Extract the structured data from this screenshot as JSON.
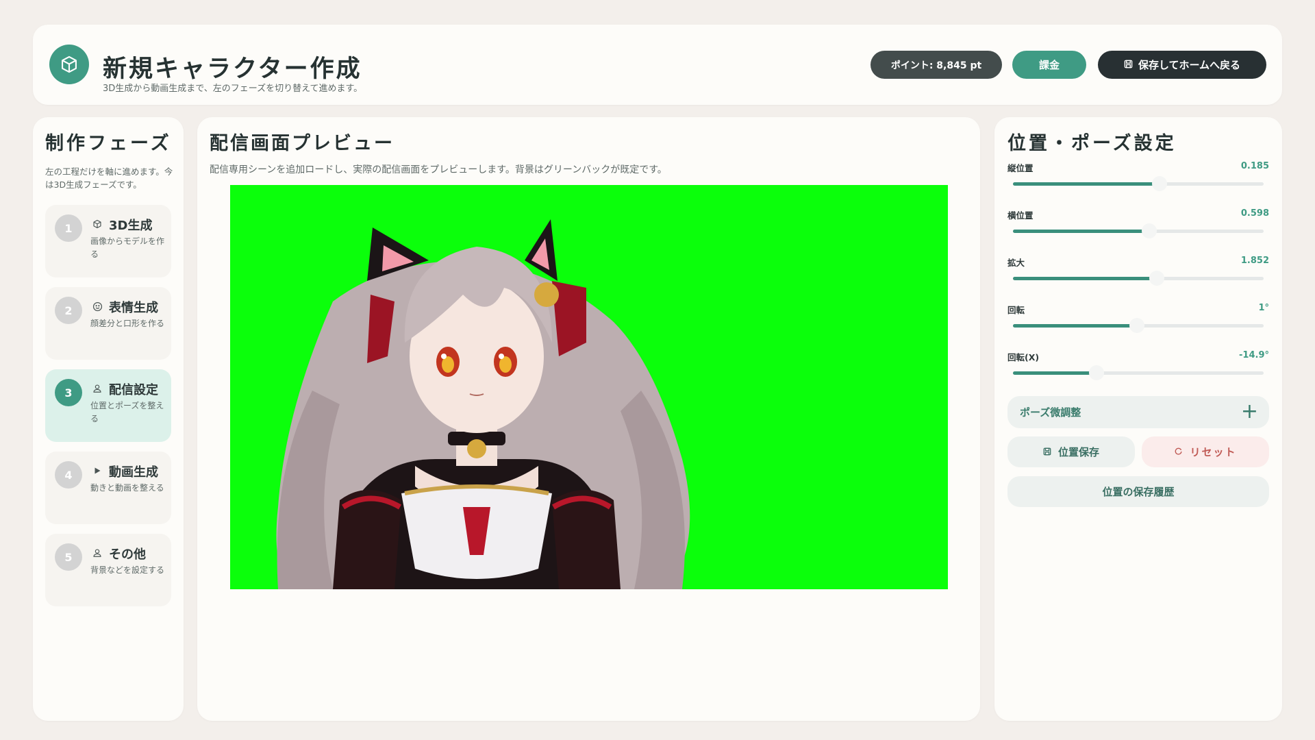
{
  "header": {
    "title": "新規キャラクター作成",
    "subtitle": "3D生成から動画生成まで、左のフェーズを切り替えて進めます。",
    "points": "ポイント: 8,845 pt",
    "charge": "課金",
    "save_home": "保存してホームへ戻る",
    "logo_icon": "cube-icon"
  },
  "sidebar": {
    "title": "制作フェーズ",
    "description": "左の工程だけを軸に進めます。今は3D生成フェーズです。",
    "phases": [
      {
        "num": "1",
        "icon": "cube-icon",
        "label": "3D生成",
        "desc": "画像からモデルを作る",
        "active": false
      },
      {
        "num": "2",
        "icon": "smile-icon",
        "label": "表情生成",
        "desc": "顔差分と口形を作る",
        "active": false
      },
      {
        "num": "3",
        "icon": "person-icon",
        "label": "配信設定",
        "desc": "位置とポーズを整える",
        "active": true
      },
      {
        "num": "4",
        "icon": "play-icon",
        "label": "動画生成",
        "desc": "動きと動画を整える",
        "active": false
      },
      {
        "num": "5",
        "icon": "person-icon",
        "label": "その他",
        "desc": "背景などを設定する",
        "active": false
      }
    ]
  },
  "preview": {
    "title": "配信画面プレビュー",
    "description": "配信専用シーンを追加ロードし、実際の配信画面をプレビューします。背景はグリーンバックが既定です。",
    "background_color": "#0bff0b"
  },
  "pose": {
    "title": "位置・ポーズ設定",
    "sliders": [
      {
        "label": "縦位置",
        "value": "0.185",
        "fill": 0.56
      },
      {
        "label": "横位置",
        "value": "0.598",
        "fill": 0.52
      },
      {
        "label": "拡大",
        "value": "1.852",
        "fill": 0.55
      },
      {
        "label": "回転",
        "value": "1°",
        "fill": 0.47
      },
      {
        "label": "回転(X)",
        "value": "-14.9°",
        "fill": 0.31
      }
    ],
    "fine_tune": "ポーズ微調整",
    "save_position": "位置保存",
    "reset": "リセット",
    "history": "位置の保存履歴"
  },
  "colors": {
    "accent": "#3f9b84",
    "dark": "#283033",
    "reset": "#c05a55"
  }
}
